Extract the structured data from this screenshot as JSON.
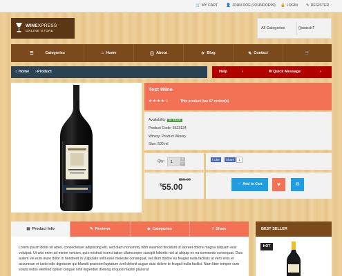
{
  "topbar": {
    "cart": "MY CART",
    "user": "JOHN DOE (JOHNDOE99)",
    "login": "LOGIN",
    "register": "REGISTER"
  },
  "logo": {
    "brand_bold": "WINE",
    "brand_light": "XPRESS",
    "subtitle": "ONLINE STORE"
  },
  "search": {
    "category": "All Categories",
    "value": "{{searchT"
  },
  "nav": {
    "categories": "Categories",
    "home": "Home",
    "about": "About",
    "blog": "Blog",
    "contact": "Contact"
  },
  "breadcrumb": {
    "home": "Home",
    "current": "Product"
  },
  "helpbar": {
    "help": "Help",
    "quick": "Quick Message"
  },
  "product": {
    "name": "Test Wine",
    "stars": "★★★★☆",
    "rating": 4,
    "reviews": "This product has 67 review(s)",
    "availability_label": "Availability:",
    "availability": "In Stock",
    "code": "Product Code: 6523124",
    "winery": "Winery: Product Winery",
    "size": "Size: 500 ml",
    "qty_label": "Qty:",
    "qty": "1",
    "old_price": "$55.00",
    "price_currency": "$",
    "price": "$55.00",
    "add_to_cart": "Add to Cart"
  },
  "share": {
    "like": "Like",
    "share": "Share",
    "count": "1"
  },
  "tabs": [
    "Product Info",
    "Reviews",
    "Categories",
    "Share"
  ],
  "description": "Lorem ipsum dolor sit amet, consectetuer adipiscing elit, sed diam nonummy nibh euismod tincidunt ut laoreet dolore magna aliquam erat volutpat. Ut wisi enim ad minim veniam, quis nostrud exerci tation ullamcorper suscipit lobortis nisl ut aliquip ex ea commodo consequat. Duis autem vel eum iriure dolor in hendrerit in vulputate velit esse molestie consequat, vel illum dolore eu feugiat nulla facilisis at vero eros et accumsan et iusto odio dignissim qui blandit praesent luptatum zzril delenit augue duis dolore te feugait nulla facilisi. Nam liber tempor cum soluta nobis eleifend option congue nihil imperdiet doming id quod mazim placerat",
  "bestseller": {
    "title": "BEST SELLER",
    "badge": "HOT"
  },
  "colors": {
    "nav_brown": "#7a4a1c",
    "breadcrumb_navy": "#2b4154",
    "help_red": "#b20000",
    "accent_salmon": "#f37155",
    "button_blue": "#1e9ee0",
    "stock_green": "#4e9a45"
  },
  "icons": [
    "cart-icon",
    "user-icon",
    "login-icon",
    "register-icon",
    "menu-icon",
    "home-icon",
    "info-icon",
    "blog-icon",
    "pencil-icon",
    "shopping-cart-icon",
    "chevron-left-icon",
    "chevron-right-icon",
    "heart-icon",
    "mail-icon",
    "tag-icon",
    "share-icon",
    "list-icon",
    "comment-icon"
  ]
}
